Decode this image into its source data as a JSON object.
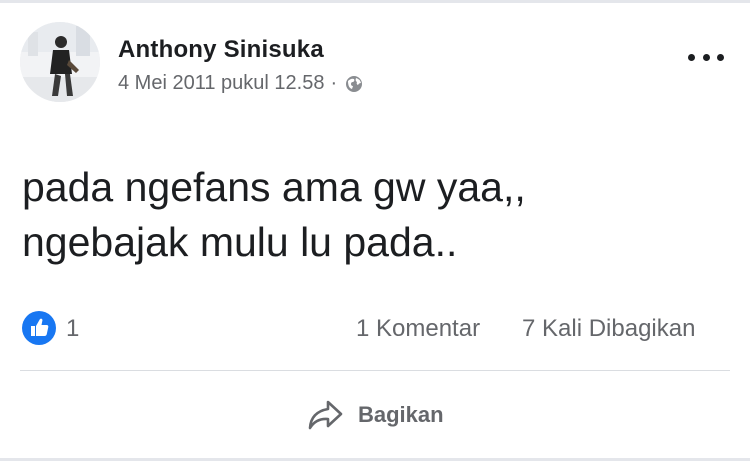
{
  "post": {
    "author": "Anthony Sinisuka",
    "timestamp": "4 Mei 2011 pukul 12.58",
    "separator": "·",
    "privacy_icon": "globe-icon",
    "text_lines": [
      "pada ngefans ama gw yaa,,",
      "ngebajak mulu lu pada.."
    ]
  },
  "stats": {
    "reaction_icon": "like-icon",
    "like_count": "1",
    "comments": "1 Komentar",
    "shares": "7 Kali Dibagikan"
  },
  "actions": {
    "share_label": "Bagikan",
    "share_icon": "share-arrow-icon"
  },
  "colors": {
    "like_blue": "#1877f2",
    "secondary_text": "#65676b",
    "primary_text": "#1c1e21"
  }
}
